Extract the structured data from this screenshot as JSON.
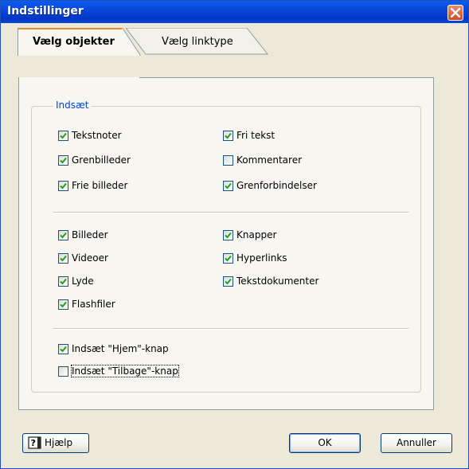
{
  "window": {
    "title": "Indstillinger"
  },
  "tabs": [
    {
      "label": "Vælg objekter",
      "active": true
    },
    {
      "label": "Vælg linktype",
      "active": false
    }
  ],
  "group": {
    "label": "Indsæt",
    "section1": [
      {
        "label": "Tekstnoter",
        "checked": true
      },
      {
        "label": "Fri tekst",
        "checked": true
      },
      {
        "label": "Grenbilleder",
        "checked": true
      },
      {
        "label": "Kommentarer",
        "checked": false
      },
      {
        "label": "Frie billeder",
        "checked": true
      },
      {
        "label": "Grenforbindelser",
        "checked": true
      }
    ],
    "section2": [
      {
        "label": "Billeder",
        "checked": true
      },
      {
        "label": "Knapper",
        "checked": true
      },
      {
        "label": "Videoer",
        "checked": true
      },
      {
        "label": "Hyperlinks",
        "checked": true
      },
      {
        "label": "Lyde",
        "checked": true
      },
      {
        "label": "Tekstdokumenter",
        "checked": true
      },
      {
        "label": "Flashfiler",
        "checked": true
      }
    ],
    "section3": [
      {
        "label": "Indsæt \"Hjem\"-knap",
        "checked": true
      },
      {
        "label": "Indsæt \"Tilbage\"-knap",
        "checked": false
      }
    ]
  },
  "buttons": {
    "help": "Hjælp",
    "ok": "OK",
    "cancel": "Annuller"
  },
  "colors": {
    "titlebar": "#0a46d6",
    "groupLabel": "#0046d5",
    "check": "#21a121",
    "close": "#d34a22"
  }
}
